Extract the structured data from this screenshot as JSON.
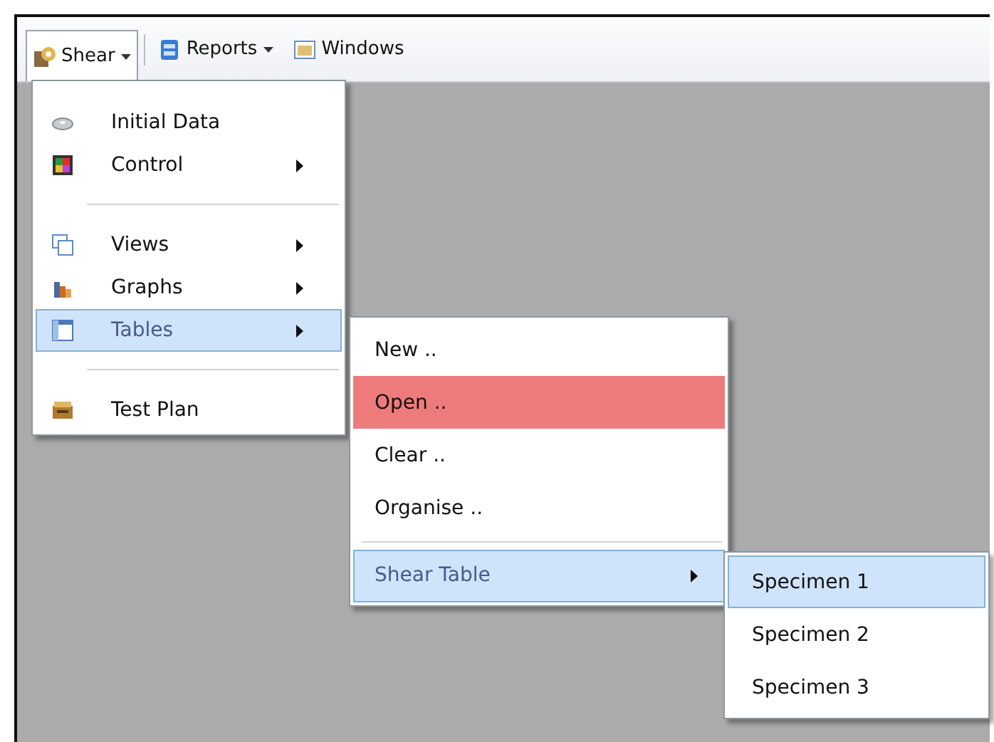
{
  "toolbar": [
    {
      "label": "Shear",
      "dropdown": true,
      "open": true
    },
    {
      "label": "Reports",
      "dropdown": true,
      "open": false
    },
    {
      "label": "Windows",
      "dropdown": false,
      "open": false
    }
  ],
  "menu": [
    {
      "kind": "item",
      "label": "Initial Data",
      "submenu": false,
      "selected": false
    },
    {
      "kind": "item",
      "label": "Control",
      "submenu": true,
      "selected": false
    },
    {
      "kind": "separator"
    },
    {
      "kind": "item",
      "label": "Views",
      "submenu": true,
      "selected": false
    },
    {
      "kind": "item",
      "label": "Graphs",
      "submenu": true,
      "selected": false
    },
    {
      "kind": "item",
      "label": "Tables",
      "submenu": true,
      "selected": true
    },
    {
      "kind": "separator"
    },
    {
      "kind": "item",
      "label": "Test Plan",
      "submenu": false,
      "selected": false
    }
  ],
  "tables_menu": [
    {
      "kind": "item",
      "label": "New ..",
      "submenu": false,
      "selected": false,
      "pressed": false
    },
    {
      "kind": "item",
      "label": "Open ..",
      "submenu": false,
      "selected": false,
      "pressed": true
    },
    {
      "kind": "item",
      "label": "Clear ..",
      "submenu": false,
      "selected": false,
      "pressed": false
    },
    {
      "kind": "item",
      "label": "Organise ..",
      "submenu": false,
      "selected": false,
      "pressed": false
    },
    {
      "kind": "separator"
    },
    {
      "kind": "item",
      "label": "Shear Table",
      "submenu": true,
      "selected": true,
      "pressed": false
    }
  ],
  "shear_table_menu": [
    {
      "kind": "item",
      "label": "Specimen 1",
      "submenu": false,
      "selected": true,
      "pressed": false
    },
    {
      "kind": "item",
      "label": "Specimen 2",
      "submenu": false,
      "selected": false,
      "pressed": false
    },
    {
      "kind": "item",
      "label": "Specimen 3",
      "submenu": false,
      "selected": false,
      "pressed": false
    }
  ]
}
